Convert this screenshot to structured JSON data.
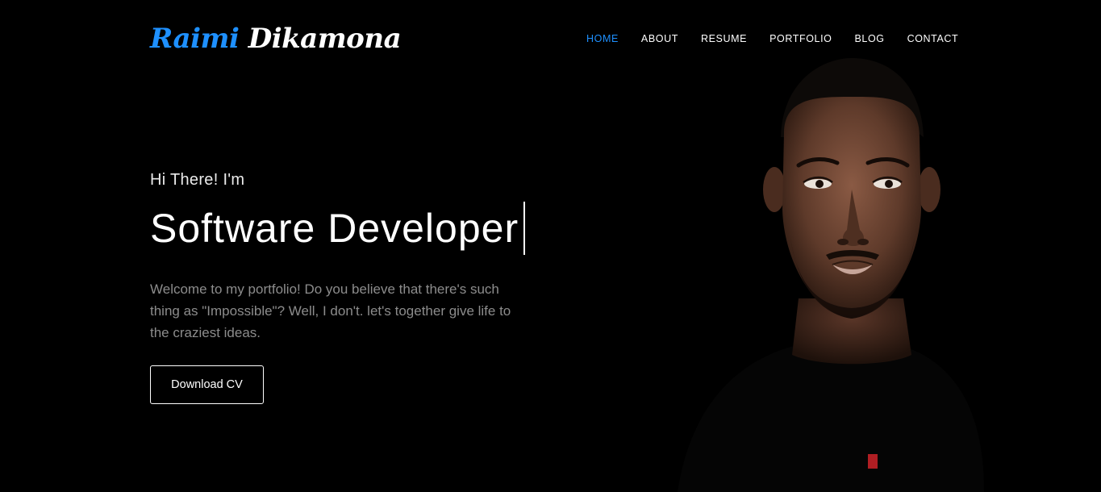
{
  "brand": {
    "first": "Raimi",
    "last": "Dikamona"
  },
  "nav": {
    "items": [
      {
        "label": "HOME",
        "active": true
      },
      {
        "label": "ABOUT",
        "active": false
      },
      {
        "label": "RESUME",
        "active": false
      },
      {
        "label": "PORTFOLIO",
        "active": false
      },
      {
        "label": "BLOG",
        "active": false
      },
      {
        "label": "CONTACT",
        "active": false
      }
    ]
  },
  "hero": {
    "greeting": "Hi There! I'm",
    "role": "Software Developer",
    "intro": "Welcome to my portfolio! Do you believe that there's such thing as \"Impossible\"? Well, I don't. let's together give life to the craziest ideas.",
    "cta_label": "Download CV"
  },
  "colors": {
    "accent": "#1e90ff",
    "background": "#000000",
    "muted_text": "#8c8c8c"
  }
}
